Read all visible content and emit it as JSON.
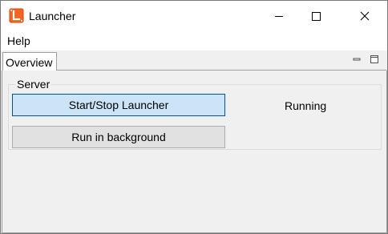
{
  "window": {
    "title": "Launcher",
    "app_icon": "launcher-app-icon",
    "controls": [
      "minimize-icon",
      "maximize-icon",
      "close-icon"
    ]
  },
  "menubar": {
    "items": [
      {
        "label": "Help"
      }
    ]
  },
  "tabs": [
    {
      "label": "Overview",
      "selected": true
    }
  ],
  "view_controls": [
    "view-minimize-icon",
    "view-maximize-icon"
  ],
  "server": {
    "group_label": "Server",
    "start_stop_label": "Start/Stop Launcher",
    "status": "Running",
    "background_label": "Run in background"
  },
  "colors": {
    "accent_button_bg": "#cce4f7",
    "accent_button_border": "#005499",
    "app_icon_orange": "#f26522"
  }
}
